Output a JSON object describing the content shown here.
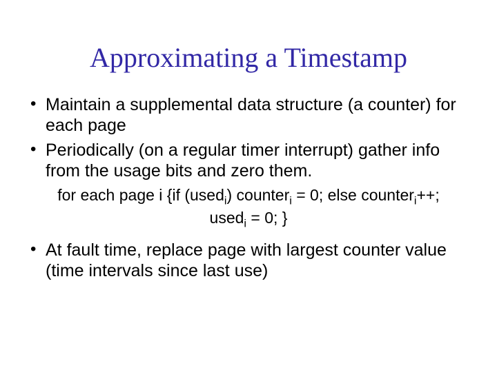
{
  "title": "Approximating a Timestamp",
  "bullets": {
    "b1": "Maintain a supplemental data structure (a counter) for each page",
    "b2": "Periodically (on a regular timer interrupt) gather info from the usage bits and zero them.",
    "b3": "At fault time, replace page with largest counter value (time intervals since last use)"
  },
  "code": {
    "p1": "for each page i {if (used",
    "p2": ") counter",
    "p3": " = 0; else counter",
    "p4": "++; used",
    "p5": " = 0; }",
    "sub": "i"
  }
}
